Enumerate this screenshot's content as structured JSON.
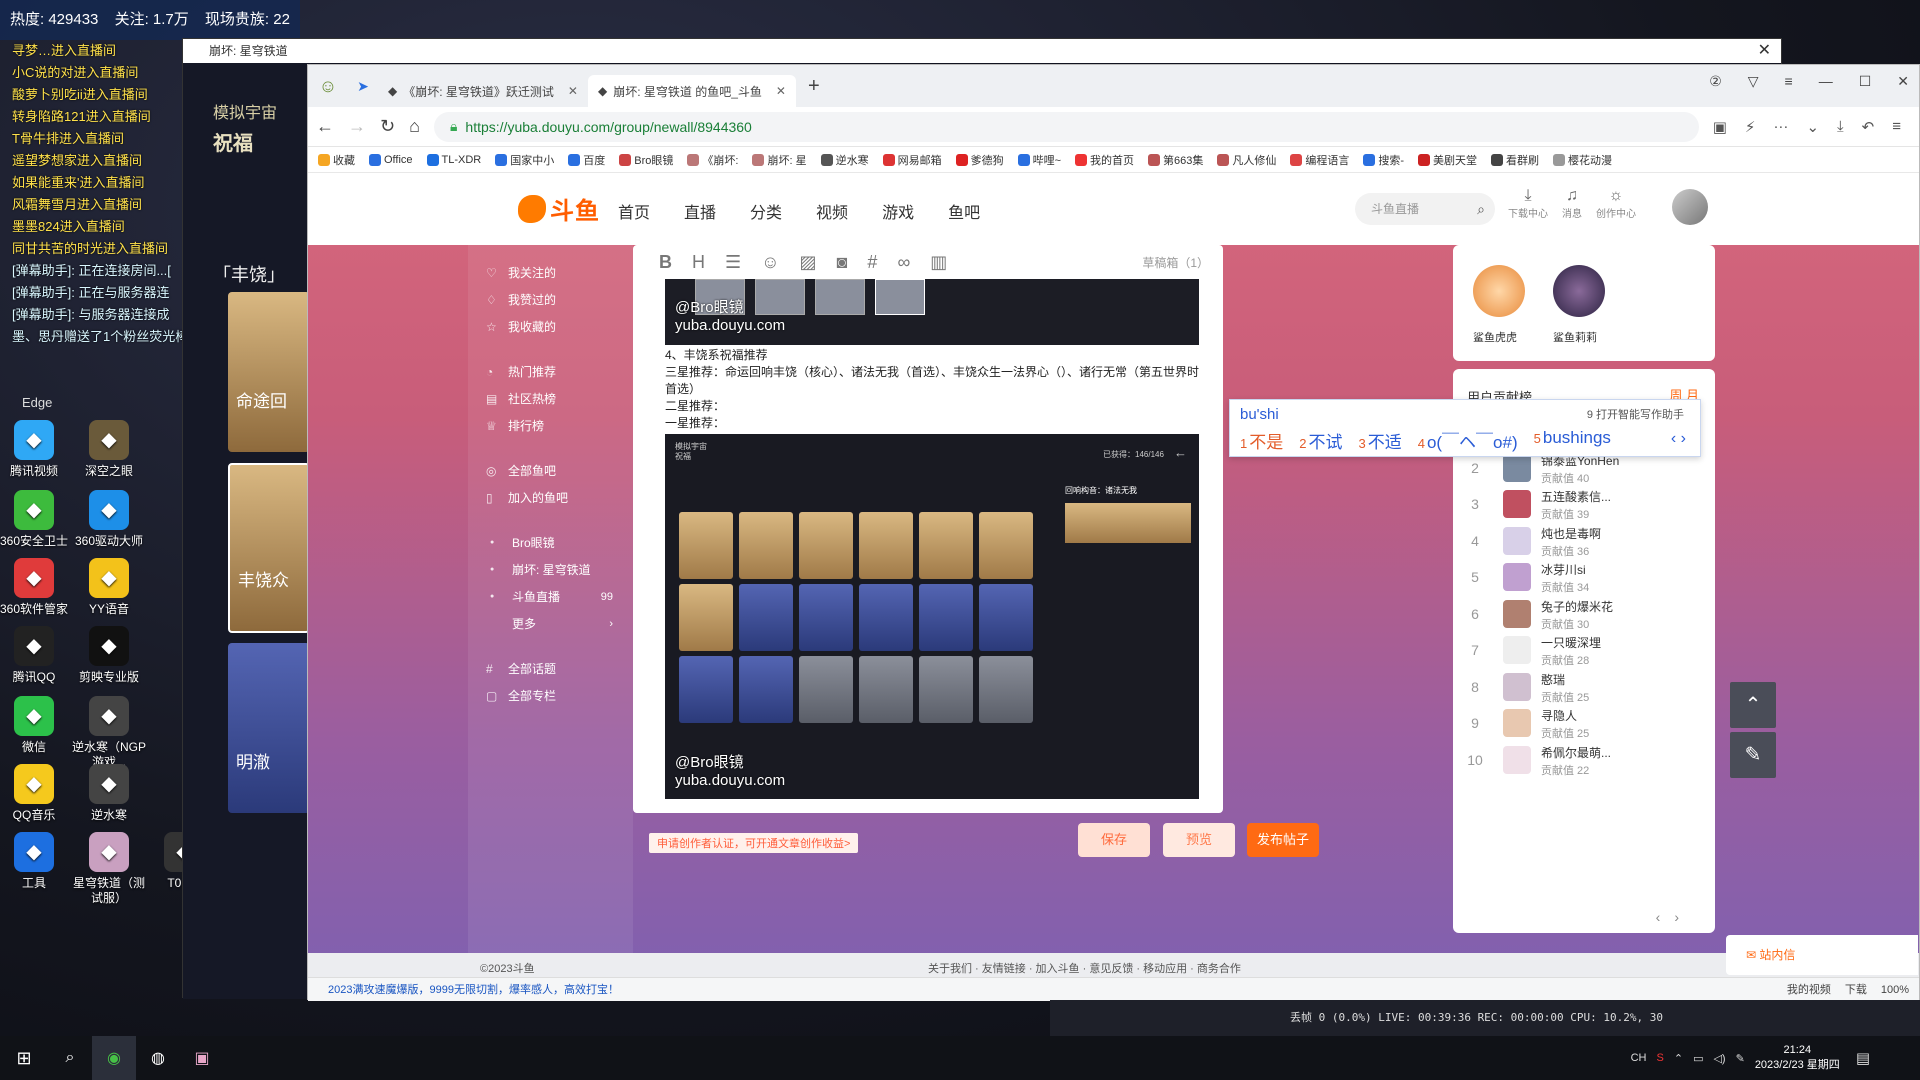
{
  "stream_overlay": {
    "heat": "热度: 429433",
    "follow": "关注: 1.7万",
    "nobles": "现场贵族: 22",
    "chat": [
      "寻梦…进入直播间",
      "小C说的对进入直播间",
      "酸萝卜别吃ii进入直播间",
      "转身陷路121进入直播间",
      "T骨牛排进入直播间",
      "遥望梦想家进入直播间",
      "如果能重来'进入直播间",
      "风霜舞雪月进入直播间",
      "墨墨824进入直播间",
      "同甘共苦的时光进入直播间",
      "[弹幕助手]: 正在连接房间...[",
      "[弹幕助手]: 正在与服务器连",
      "[弹幕助手]: 与服务器连接成",
      "墨、思丹赠送了1个粉丝荧光棒"
    ],
    "edge_label": "Edge"
  },
  "desktop_icons": [
    {
      "label": "腾讯视频",
      "icon": "tencent-video-icon",
      "color": "#2fa8f5"
    },
    {
      "label": "深空之眼",
      "icon": "game-icon",
      "color": "#6a5a3a"
    },
    {
      "label": "360安全卫士",
      "icon": "shield-icon",
      "color": "#3dbb3d"
    },
    {
      "label": "360驱动大师",
      "icon": "driver-icon",
      "color": "#1d8fe8"
    },
    {
      "label": "360软件管家",
      "icon": "apps-icon",
      "color": "#e03b3b"
    },
    {
      "label": "YY语音",
      "icon": "yy-icon",
      "color": "#f3c21a"
    },
    {
      "label": "腾讯QQ",
      "icon": "qq-icon",
      "color": "#222"
    },
    {
      "label": "剪映专业版",
      "icon": "capcut-icon",
      "color": "#111"
    },
    {
      "label": "微信",
      "icon": "wechat-icon",
      "color": "#2cc14a"
    },
    {
      "label": "逆水寒（NGP游戏...",
      "icon": "game-icon",
      "color": "#444"
    },
    {
      "label": "QQ音乐",
      "icon": "music-icon",
      "color": "#f5c91d"
    },
    {
      "label": "逆水寒",
      "icon": "game-icon",
      "color": "#444"
    },
    {
      "label": "工具",
      "icon": "tool-icon",
      "color": "#1d6fe0"
    },
    {
      "label": "星穹铁道（测试服）",
      "icon": "game-icon",
      "color": "#c9a0c0"
    },
    {
      "label": "T0.jpg",
      "icon": "image-icon",
      "color": "#333"
    }
  ],
  "game_window": {
    "title": "崩坏: 星穹铁道",
    "left_title1": "模拟宇宙",
    "left_title2": "祝福",
    "path_label": "「丰饶」",
    "cards": [
      "命途回",
      "丰饶众",
      "明澈"
    ]
  },
  "browser": {
    "tabs": [
      {
        "label": "《崩坏: 星穹铁道》跃迁测试",
        "active": false
      },
      {
        "label": "崩坏: 星穹铁道 的鱼吧_斗鱼",
        "active": true
      }
    ],
    "url": "https://yuba.douyu.com/group/newall/8944360",
    "bookmarks": [
      "收藏",
      "Office",
      "TL-XDR",
      "国家中小",
      "百度",
      "Bro眼镜",
      "《崩坏:",
      "崩坏: 星",
      "逆水寒",
      "网易邮箱",
      "爹德狗",
      "哔哩~",
      "我的首页",
      "第663集",
      "凡人修仙",
      "编程语言",
      "搜索-",
      "美剧天堂",
      "看群刷",
      "樱花动漫"
    ],
    "status_left": "2023满攻速魔爆版，9999无限切割，爆率感人，高效打宝！",
    "status_right": [
      "我的视频",
      "下载",
      "100%"
    ]
  },
  "site": {
    "logo": "斗鱼",
    "nav": [
      "首页",
      "直播",
      "分类",
      "视频",
      "游戏",
      "鱼吧"
    ],
    "search_placeholder": "斗鱼直播",
    "tools": [
      "下载中心",
      "消息",
      "创作中心"
    ],
    "side_menu": {
      "group1": [
        "我关注的",
        "我赞过的",
        "我收藏的"
      ],
      "group2": [
        "热门推荐",
        "社区热榜",
        "排行榜"
      ],
      "group3": [
        "全部鱼吧",
        "加入的鱼吧"
      ],
      "group4": [
        "Bro眼镜",
        "崩坏: 星穹铁道",
        "斗鱼直播",
        "更多"
      ],
      "badge": "99",
      "group5": [
        "全部话题",
        "全部专栏"
      ]
    },
    "editor": {
      "draft": "草稿箱（1）",
      "watermark_1": "@Bro眼镜",
      "watermark_2": "yuba.douyu.com",
      "line1": "4、丰饶系祝福推荐",
      "line2": "三星推荐：命运回响丰饶（核心）、诸法无我（首选）、丰饶众生一法界心（）、诸行无常（第五世界时首选）",
      "line3": "二星推荐：",
      "line4": "一星推荐：",
      "shot_title": "模拟宇宙",
      "shot_sub": "祝福",
      "shot_count": "已获得：146/146",
      "shot_panel": "回响构音：诸法无我",
      "cert_link": "申请创作者认证，可开通文章创作收益>",
      "save": "保存",
      "preview": "预览",
      "publish": "发布帖子"
    },
    "top_fans": [
      {
        "name": "鲨鱼虎虎"
      },
      {
        "name": "鲨鱼莉莉"
      }
    ],
    "rank": {
      "title": "用户贡献榜",
      "tabs": "周 月",
      "rows": [
        {
          "no": "1",
          "name": "",
          "score": "贡献值 98"
        },
        {
          "no": "2",
          "name": "锦泰蓝YonHen",
          "score": "贡献值 40"
        },
        {
          "no": "3",
          "name": "五连酸素信...",
          "score": "贡献值 39"
        },
        {
          "no": "4",
          "name": "炖也是毒啊",
          "score": "贡献值 36"
        },
        {
          "no": "5",
          "name": "冰芽川si",
          "score": "贡献值 34"
        },
        {
          "no": "6",
          "name": "兔子的爆米花",
          "score": "贡献值 30"
        },
        {
          "no": "7",
          "name": "一只暖深埋",
          "score": "贡献值 28"
        },
        {
          "no": "8",
          "name": "憨瑞",
          "score": "贡献值 25"
        },
        {
          "no": "9",
          "name": "寻隐人",
          "score": "贡献值 25"
        },
        {
          "no": "10",
          "name": "希佩尔最萌...",
          "score": "贡献值 22"
        }
      ]
    },
    "inbox": "站内信",
    "footer_copy": "©2023斗鱼",
    "footer_links": "关于我们 · 友情链接 · 加入斗鱼 · 意见反馈 · 移动应用 · 商务合作"
  },
  "ime": {
    "pinyin": "bu'shi",
    "helper": "9 打开智能写作助手",
    "candidates": [
      "不是",
      "不试",
      "不适",
      "o(￣ヘ￣o#)",
      "bushings"
    ]
  },
  "obs": {
    "text": "丢帧 0 (0.0%)   LIVE: 00:39:36   REC: 00:00:00   CPU: 10.2%, 30"
  },
  "taskbar": {
    "time": "21:24",
    "date": "2023/2/23 星期四",
    "ime_lang": "CH"
  }
}
